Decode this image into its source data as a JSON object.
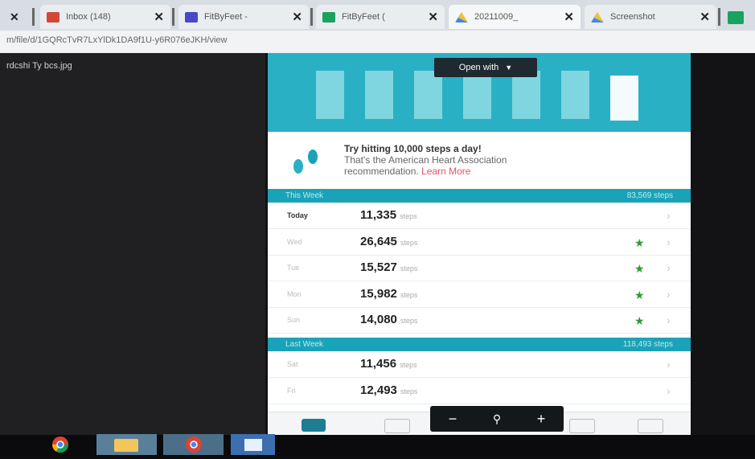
{
  "browser": {
    "tabs": [
      {
        "title": "Inbox (148)",
        "fav": "#d44638"
      },
      {
        "title": "FitByFeet -",
        "fav": "#4a47c6"
      },
      {
        "title": "FitByFeet (",
        "fav": "#1aa260"
      },
      {
        "title": "20211009_",
        "fav": "#f1c232"
      },
      {
        "title": "Screenshot",
        "fav": "#1a73e8"
      }
    ],
    "close_glyph": "✕",
    "url": "m/file/d/1GQRcTvR7LxYlDk1DA9f1U-y6R076eJKH/view"
  },
  "viewer": {
    "filename": "rdcshi Ty bcs.jpg",
    "open_with": "Open with",
    "zoom_out": "−",
    "zoom_in": "+",
    "zoom_icon": "zoom-icon"
  },
  "screenshot": {
    "tip_line1": "Try hitting 10,000 steps a day!",
    "tip_line2": "That's the American Heart Association",
    "tip_line3_prefix": "recommendation.",
    "learn_more": "Learn More",
    "this_week": {
      "label": "This Week",
      "total": "83,569 steps"
    },
    "last_week": {
      "label": "Last Week",
      "total": "118,493 steps"
    },
    "unit": "steps",
    "star_glyph": "★",
    "chevron_glyph": "›",
    "rows_this_week": [
      {
        "day": "Today",
        "steps": "11,335",
        "star": false,
        "today": true
      },
      {
        "day": "Wed",
        "steps": "26,645",
        "star": true
      },
      {
        "day": "Tue",
        "steps": "15,527",
        "star": true
      },
      {
        "day": "Mon",
        "steps": "15,982",
        "star": true
      },
      {
        "day": "Sun",
        "steps": "14,080",
        "star": true
      }
    ],
    "rows_last_week": [
      {
        "day": "Sat",
        "steps": "11,456",
        "star": false
      },
      {
        "day": "Fri",
        "steps": "12,493",
        "star": false
      }
    ]
  },
  "colors": {
    "teal": "#2ab0c5",
    "header_teal": "#1aa3b8",
    "star_green": "#2f9a2f",
    "learn_pink": "#e0556a"
  }
}
